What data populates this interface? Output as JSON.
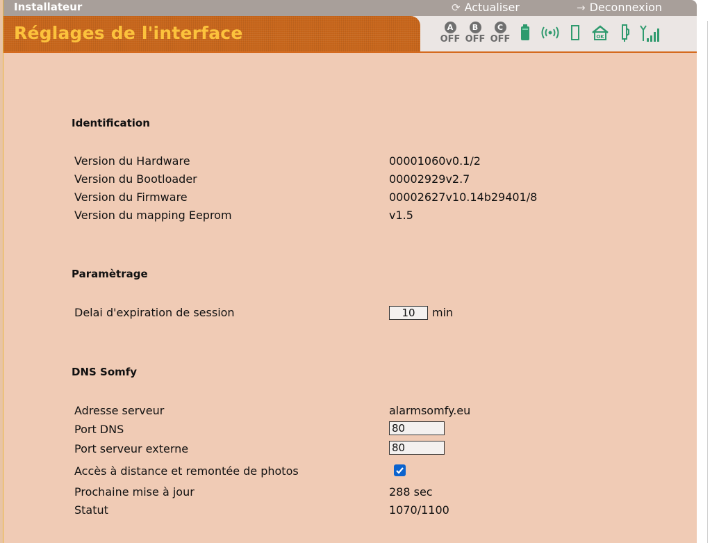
{
  "topbar": {
    "role": "Installateur",
    "refresh_label": "Actualiser",
    "logout_label": "Deconnexion"
  },
  "header": {
    "title": "Réglages de l'interface",
    "zones": [
      {
        "letter": "A",
        "state": "OFF"
      },
      {
        "letter": "B",
        "state": "OFF"
      },
      {
        "letter": "C",
        "state": "OFF"
      }
    ],
    "icons": [
      "battery-icon",
      "radio-signal-icon",
      "door-sensor-icon",
      "home-ok-icon",
      "tamper-icon",
      "gsm-signal-icon"
    ]
  },
  "identification": {
    "title": "Identification",
    "rows": [
      {
        "label": "Version du Hardware",
        "value": "00001060v0.1/2"
      },
      {
        "label": "Version du Bootloader",
        "value": "00002929v2.7"
      },
      {
        "label": "Version du Firmware",
        "value": "00002627v10.14b29401/8"
      },
      {
        "label": "Version du mapping Eeprom",
        "value": "v1.5"
      }
    ]
  },
  "parametrage": {
    "title": "Paramètrage",
    "session_label": "Delai d'expiration de session",
    "session_value": "10",
    "session_unit": "min"
  },
  "dns": {
    "title": "DNS Somfy",
    "server_label": "Adresse serveur",
    "server_value": "alarmsomfy.eu",
    "port_dns_label": "Port DNS",
    "port_dns_value": "80",
    "port_ext_label": "Port serveur externe",
    "port_ext_value": "80",
    "remote_label": "Accès à distance et remontée de photos",
    "remote_checked": true,
    "next_update_label": "Prochaine mise à jour",
    "next_update_value": "288 sec",
    "status_label": "Statut",
    "status_value": "1070/1100"
  },
  "colors": {
    "accent": "#c8661b",
    "title": "#fcc23c",
    "content_bg": "#f0cbb5",
    "icon_green": "#2f9a6e",
    "checkbox": "#0b63ce"
  }
}
